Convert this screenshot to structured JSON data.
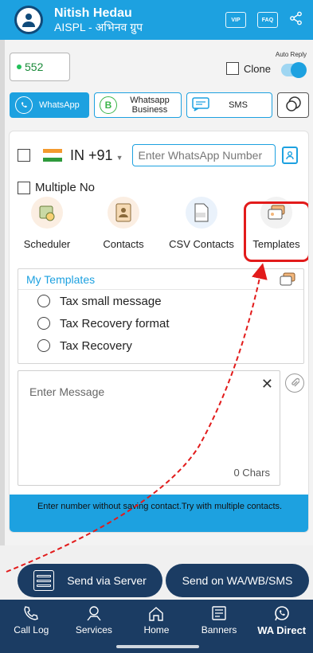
{
  "header": {
    "user_name": "Nitish Hedau",
    "org": "AISPL - अभिनव ग्रुप",
    "icons": [
      "vip-badge-icon",
      "faq-badge-icon",
      "share-icon"
    ],
    "vip_label": "VIP",
    "faq_label": "FAQ"
  },
  "top": {
    "count": "552",
    "clone_label": "Clone",
    "auto_reply_label": "Auto Reply",
    "auto_reply_on": true
  },
  "channels": [
    {
      "label": "WhatsApp",
      "active": true
    },
    {
      "label": "Whatsapp Business",
      "active": false
    },
    {
      "label": "SMS",
      "active": false
    }
  ],
  "phone": {
    "country": "IN",
    "code": "+91",
    "placeholder": "Enter WhatsApp Number"
  },
  "multiple_label": "Multiple No",
  "tools": [
    {
      "label": "Scheduler",
      "icon": "calendar-clock-icon"
    },
    {
      "label": "Contacts",
      "icon": "contacts-book-icon"
    },
    {
      "label": "CSV Contacts",
      "icon": "csv-file-icon"
    },
    {
      "label": "Templates",
      "icon": "template-cards-icon"
    }
  ],
  "templates": {
    "title": "My Templates",
    "items": [
      "Tax small message",
      "Tax Recovery format",
      "Tax Recovery"
    ]
  },
  "message": {
    "placeholder": "Enter Message",
    "chars": "0 Chars"
  },
  "info_text": "Enter number without saving contact.Try with multiple contacts.",
  "send": {
    "server_label": "Send via Server",
    "wa_label": "Send on WA/WB/SMS"
  },
  "nav": [
    {
      "label": "Call Log",
      "icon": "call-log-icon",
      "active": false
    },
    {
      "label": "Services",
      "icon": "services-icon",
      "active": false
    },
    {
      "label": "Home",
      "icon": "home-icon",
      "active": false
    },
    {
      "label": "Banners",
      "icon": "banners-icon",
      "active": false
    },
    {
      "label": "WA Direct",
      "icon": "whatsapp-icon",
      "active": true
    }
  ],
  "colors": {
    "accent": "#1da1e0",
    "nav_bg": "#1b3c63",
    "highlight": "#e21b1b"
  }
}
